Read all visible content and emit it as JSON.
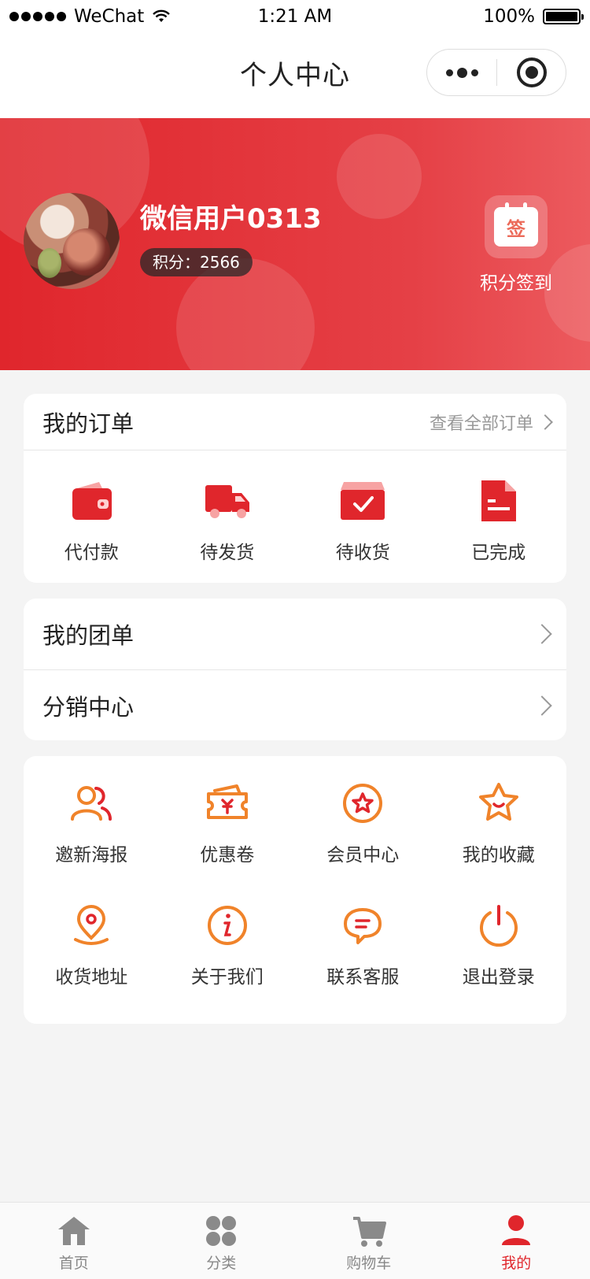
{
  "status_bar": {
    "carrier": "WeChat",
    "time": "1:21 AM",
    "battery": "100%"
  },
  "nav": {
    "title": "个人中心"
  },
  "profile": {
    "username": "微信用户0313",
    "points": "积分：2566",
    "signin_icon_text": "签",
    "signin_label": "积分签到"
  },
  "orders": {
    "title": "我的订单",
    "view_all": "查看全部订单",
    "items": [
      {
        "label": "代付款",
        "icon": "wallet-icon"
      },
      {
        "label": "待发货",
        "icon": "truck-icon"
      },
      {
        "label": "待收货",
        "icon": "package-check-icon"
      },
      {
        "label": "已完成",
        "icon": "document-icon"
      }
    ]
  },
  "links": [
    {
      "label": "我的团单"
    },
    {
      "label": "分销中心"
    }
  ],
  "services": [
    {
      "label": "邀新海报",
      "icon": "users-icon"
    },
    {
      "label": "优惠卷",
      "icon": "coupon-icon"
    },
    {
      "label": "会员中心",
      "icon": "star-circle-icon"
    },
    {
      "label": "我的收藏",
      "icon": "star-smile-icon"
    },
    {
      "label": "收货地址",
      "icon": "location-pin-icon"
    },
    {
      "label": "关于我们",
      "icon": "info-icon"
    },
    {
      "label": "联系客服",
      "icon": "chat-bubble-icon"
    },
    {
      "label": "退出登录",
      "icon": "power-icon"
    }
  ],
  "tabbar": [
    {
      "label": "首页",
      "icon": "home-icon",
      "active": false
    },
    {
      "label": "分类",
      "icon": "category-icon",
      "active": false
    },
    {
      "label": "购物车",
      "icon": "cart-icon",
      "active": false
    },
    {
      "label": "我的",
      "icon": "user-icon",
      "active": true
    }
  ],
  "colors": {
    "brand_red": "#e0262c",
    "accent_orange": "#f0832a",
    "tab_inactive": "#888888"
  }
}
